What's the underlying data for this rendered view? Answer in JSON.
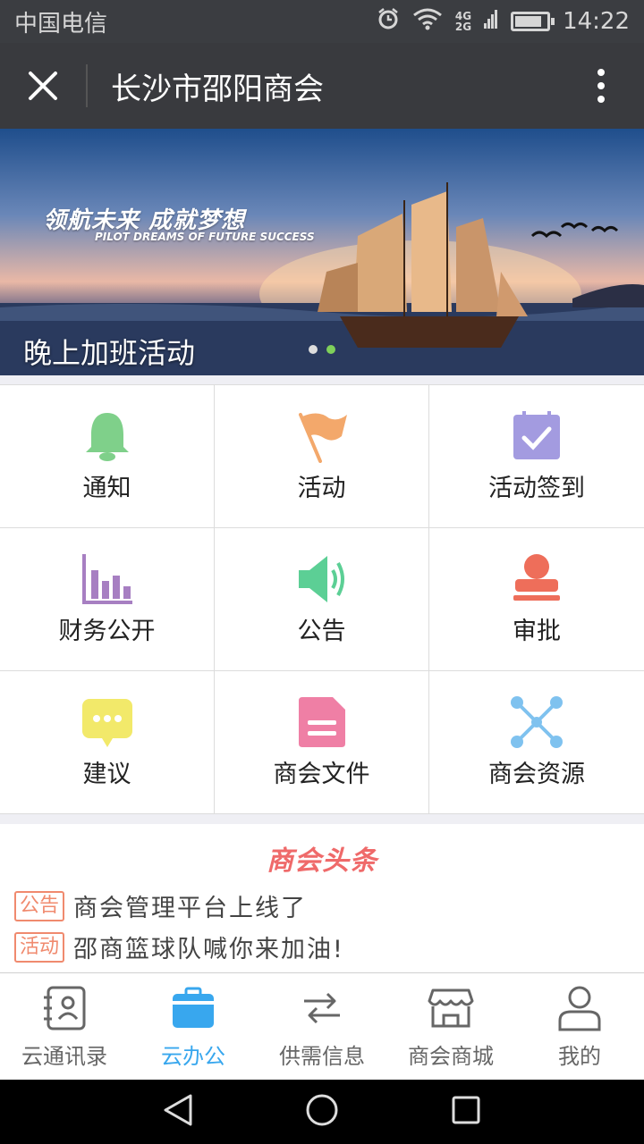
{
  "status_bar": {
    "carrier": "中国电信",
    "network_top": "4G",
    "network_bottom": "2G",
    "time": "14:22",
    "battery_level": 0.85
  },
  "title_bar": {
    "title": "长沙市邵阳商会"
  },
  "banner": {
    "slogan_cn": "领航未来 成就梦想",
    "slogan_en": "PILOT DREAMS OF FUTURE SUCCESS",
    "caption": "晚上加班活动",
    "slide_count": 2,
    "active_slide": 2
  },
  "grid": {
    "items": [
      {
        "label": "通知",
        "icon": "bell-icon",
        "color": "#7fd08a"
      },
      {
        "label": "活动",
        "icon": "flag-icon",
        "color": "#f3a86b"
      },
      {
        "label": "活动签到",
        "icon": "calendar-check-icon",
        "color": "#a39be0"
      },
      {
        "label": "财务公开",
        "icon": "bar-chart-icon",
        "color": "#a77fc2"
      },
      {
        "label": "公告",
        "icon": "speaker-icon",
        "color": "#5ccf95"
      },
      {
        "label": "审批",
        "icon": "stamp-icon",
        "color": "#ee6e5a"
      },
      {
        "label": "建议",
        "icon": "chat-bubble-icon",
        "color": "#f2e96a"
      },
      {
        "label": "商会文件",
        "icon": "document-icon",
        "color": "#ef7fa5"
      },
      {
        "label": "商会资源",
        "icon": "network-icon",
        "color": "#7fc2ef"
      }
    ]
  },
  "headlines": {
    "title": "商会头条",
    "items": [
      {
        "tag": "公告",
        "text": "商会管理平台上线了"
      },
      {
        "tag": "活动",
        "text": "邵商篮球队喊你来加油!"
      }
    ]
  },
  "bottom_nav": {
    "active_color": "#38a7ee",
    "items": [
      {
        "label": "云通讯录",
        "icon": "contacts-icon"
      },
      {
        "label": "云办公",
        "icon": "briefcase-icon"
      },
      {
        "label": "供需信息",
        "icon": "exchange-icon"
      },
      {
        "label": "商会商城",
        "icon": "store-icon"
      },
      {
        "label": "我的",
        "icon": "user-icon"
      }
    ]
  }
}
